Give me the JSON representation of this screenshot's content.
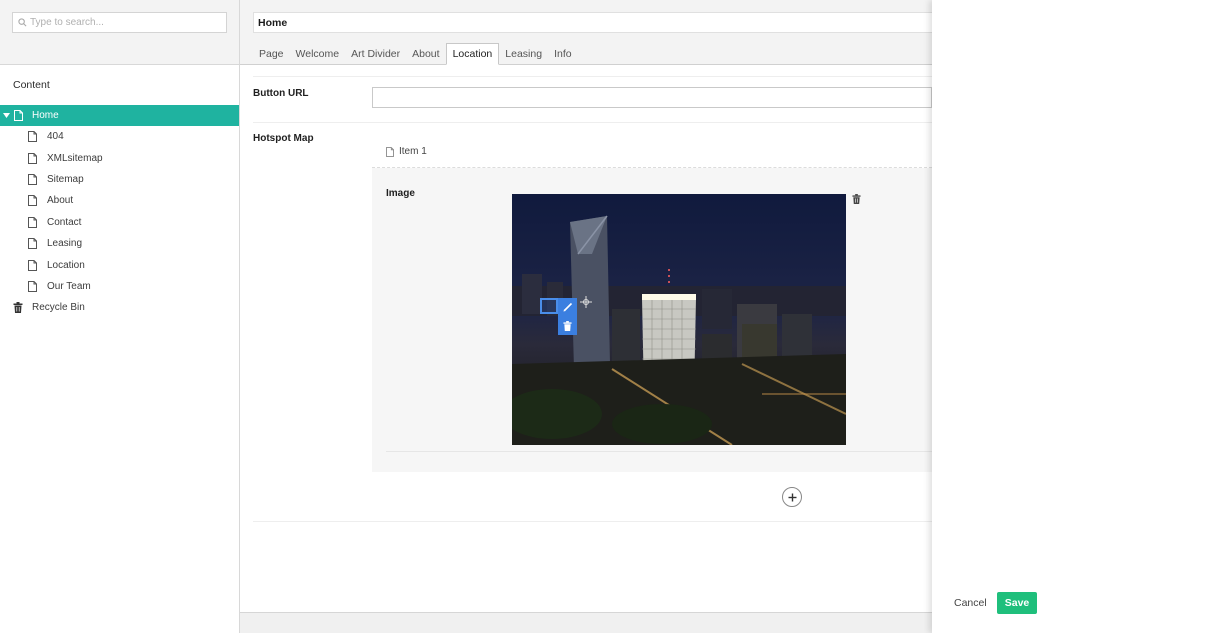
{
  "sidebar": {
    "search": {
      "placeholder": "Type to search..."
    },
    "section_title": "Content",
    "tree": {
      "root": {
        "label": "Home",
        "selected": true
      },
      "children": [
        {
          "label": "404"
        },
        {
          "label": "XMLsitemap"
        },
        {
          "label": "Sitemap"
        },
        {
          "label": "About"
        },
        {
          "label": "Contact"
        },
        {
          "label": "Leasing"
        },
        {
          "label": "Location"
        },
        {
          "label": "Our Team"
        }
      ],
      "recycle_bin": "Recycle Bin"
    }
  },
  "editor": {
    "node_name": "Home",
    "tabs": [
      {
        "label": "Page"
      },
      {
        "label": "Welcome"
      },
      {
        "label": "Art Divider"
      },
      {
        "label": "About"
      },
      {
        "label": "Location",
        "active": true
      },
      {
        "label": "Leasing"
      },
      {
        "label": "Info"
      }
    ],
    "properties": {
      "button_url": {
        "label": "Button URL",
        "value": ""
      },
      "hotspot_map": {
        "label": "Hotspot Map",
        "item_label": "Item 1",
        "image_label": "Image"
      }
    }
  },
  "actions": {
    "cancel": "Cancel",
    "save": "Save"
  },
  "colors": {
    "accent_teal": "#1fb3a0",
    "save_green": "#1fbf7c",
    "hotspot_blue": "#3b7fe0"
  }
}
